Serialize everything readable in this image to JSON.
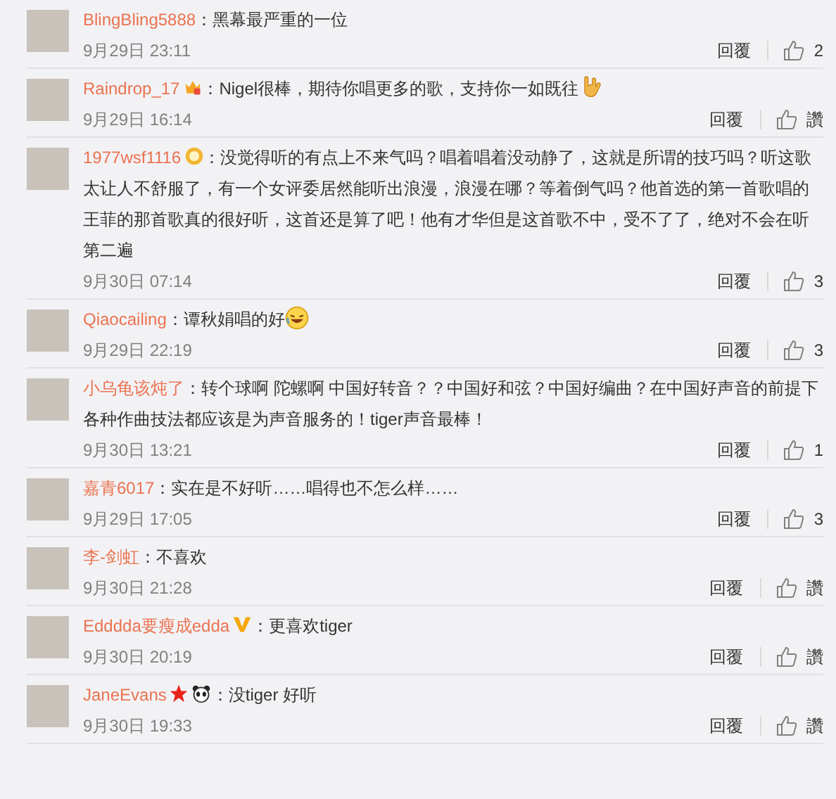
{
  "comments": [
    {
      "user": "BlingBling5888",
      "text": "：黑幕最严重的一位",
      "time": "9月29日 23:11",
      "reply": "回覆",
      "likes": "2"
    },
    {
      "user": "Raindrop_17",
      "badges": [
        {
          "kind": "crown"
        }
      ],
      "text": "：Nigel很棒，期待你唱更多的歌，支持你一如既往",
      "emoji": {
        "kind": "hand"
      },
      "time": "9月29日 16:14",
      "reply": "回覆",
      "likes": "讚"
    },
    {
      "user": "1977wsf1116",
      "badges": [
        {
          "kind": "medal"
        }
      ],
      "text": "：没觉得听的有点上不来气吗？唱着唱着没动静了，这就是所谓的技巧吗？听这歌太让人不舒服了，有一个女评委居然能听出浪漫，浪漫在哪？等着倒气吗？他首选的第一首歌唱的王菲的那首歌真的很好听，这首还是算了吧！他有才华但是这首歌不中，受不了了，绝对不会在听第二遍",
      "time": "9月30日 07:14",
      "reply": "回覆",
      "likes": "3"
    },
    {
      "user": "Qiaocailing",
      "text": "：谭秋娟唱的好",
      "emoji": {
        "kind": "laugh"
      },
      "time": "9月29日 22:19",
      "reply": "回覆",
      "likes": "3"
    },
    {
      "user": "小乌龟该炖了",
      "text": "：转个球啊 陀螺啊 中国好转音？？中国好和弦？中国好编曲？在中国好声音的前提下各种作曲技法都应该是为声音服务的！tiger声音最棒！",
      "time": "9月30日 13:21",
      "reply": "回覆",
      "likes": "1"
    },
    {
      "user": "嘉青6017",
      "text": "：实在是不好听……唱得也不怎么样……",
      "time": "9月29日 17:05",
      "reply": "回覆",
      "likes": "3"
    },
    {
      "user": "李-剑虹",
      "text": "：不喜欢",
      "time": "9月30日 21:28",
      "reply": "回覆",
      "likes": "讚"
    },
    {
      "user": "Edddda要瘦成edda",
      "badges": [
        {
          "kind": "v"
        }
      ],
      "text": "：更喜欢tiger",
      "time": "9月30日 20:19",
      "reply": "回覆",
      "likes": "讚"
    },
    {
      "user": "JaneEvans",
      "badges": [
        {
          "kind": "star"
        },
        {
          "kind": "panda"
        }
      ],
      "text": "：没tiger 好听",
      "time": "9月30日 19:33",
      "reply": "回覆",
      "likes": "讚"
    }
  ]
}
